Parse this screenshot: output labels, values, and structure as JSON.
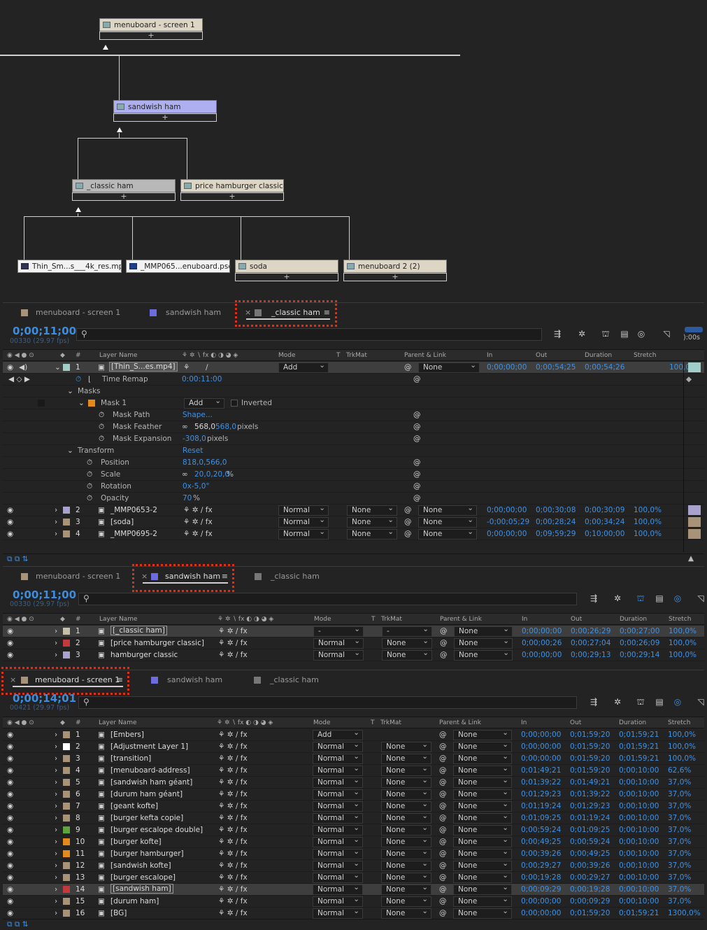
{
  "flowchart": {
    "nodes": [
      {
        "label": "menuboard - screen 1"
      },
      {
        "label": "sandwish ham"
      },
      {
        "label": "_classic ham"
      },
      {
        "label": "price hamburger classic"
      },
      {
        "label": "Thin_Sm...s___4k_res.mp4"
      },
      {
        "label": "_MMP065...enuboard.psd"
      },
      {
        "label": "soda"
      },
      {
        "label": "menuboard 2 (2)"
      }
    ],
    "plus": "+"
  },
  "panel1": {
    "tabs": [
      {
        "label": "menuboard - screen 1"
      },
      {
        "label": "sandwish ham"
      },
      {
        "label": "_classic ham"
      }
    ],
    "timecode": "0;00;11;00",
    "fps": "00330 (29.97 fps)",
    "headers": {
      "layer_name": "Layer Name",
      "mode": "Mode",
      "t": "T",
      "trkmat": "TrkMat",
      "parent": "Parent & Link",
      "in": "In",
      "out": "Out",
      "duration": "Duration",
      "stretch": "Stretch"
    },
    "timeline_label": "):00s",
    "layer1": {
      "num": "1",
      "name": "[Thin_S...es.mp4]",
      "mode": "Add",
      "parent": "None",
      "in": "0;00;00;00",
      "out": "0;00;54;25",
      "dur": "0;00;54;26",
      "stretch": "100,0%"
    },
    "props": [
      {
        "label": "Time Remap",
        "value": "0:00:11:00"
      },
      {
        "label": "Masks",
        "value": ""
      },
      {
        "label": "Mask 1",
        "value": "Add",
        "extra": "Inverted"
      },
      {
        "label": "Mask Path",
        "value": "Shape..."
      },
      {
        "label": "Mask Feather",
        "value": "568,0",
        "value2": "568,0",
        "unit": "pixels"
      },
      {
        "label": "Mask Expansion",
        "value": "-308,0",
        "unit": "pixels"
      },
      {
        "label": "Transform",
        "value": "Reset"
      },
      {
        "label": "Position",
        "value": "818,0,566,0"
      },
      {
        "label": "Scale",
        "value": "20,0,20,0",
        "unit": "%"
      },
      {
        "label": "Rotation",
        "value": "0x-5,0°"
      },
      {
        "label": "Opacity",
        "value": "70",
        "unit": "%"
      }
    ],
    "layers": [
      {
        "num": "2",
        "name": "_MMP0653-2",
        "mode": "Normal",
        "trk": "None",
        "parent": "None",
        "in": "0;00;00;00",
        "out": "0;00;30;08",
        "dur": "0;00;30;09",
        "stretch": "100,0%",
        "color": "#a9a2cc"
      },
      {
        "num": "3",
        "name": "[soda]",
        "mode": "Normal",
        "trk": "None",
        "parent": "None",
        "in": "-0;00;05;29",
        "out": "0;00;28;24",
        "dur": "0;00;34;24",
        "stretch": "100,0%",
        "color": "#a89278"
      },
      {
        "num": "4",
        "name": "_MMP0695-2",
        "mode": "Normal",
        "trk": "None",
        "parent": "None",
        "in": "0;00;00;00",
        "out": "0;09;59;29",
        "dur": "0;10;00;00",
        "stretch": "100,0%",
        "color": "#a89278"
      }
    ]
  },
  "panel2": {
    "tabs": [
      {
        "label": "menuboard - screen 1"
      },
      {
        "label": "sandwish ham"
      },
      {
        "label": "_classic ham"
      }
    ],
    "timecode": "0;00;11;00",
    "fps": "00330 (29.97 fps)",
    "layers": [
      {
        "num": "1",
        "name": "[_classic ham]",
        "mode": "-",
        "trk": "-",
        "parent": "None",
        "in": "0;00;00;00",
        "out": "0;00;26;29",
        "dur": "0;00;27;00",
        "stretch": "100,0%",
        "color": "#c6c0a8",
        "sel": true
      },
      {
        "num": "2",
        "name": "[price hamburger classic]",
        "mode": "Normal",
        "trk": "None",
        "parent": "None",
        "in": "0;00;00;26",
        "out": "0;00;27;04",
        "dur": "0;00;26;09",
        "stretch": "100,0%",
        "color": "#c3393d"
      },
      {
        "num": "3",
        "name": "hamburger classic",
        "mode": "Normal",
        "trk": "None",
        "parent": "None",
        "in": "0;00;00;00",
        "out": "0;00;29;13",
        "dur": "0;00;29;14",
        "stretch": "100,0%",
        "color": "#a9a2cc"
      }
    ]
  },
  "panel3": {
    "tabs": [
      {
        "label": "menuboard - screen 1"
      },
      {
        "label": "sandwish ham"
      },
      {
        "label": "_classic ham"
      }
    ],
    "timecode": "0;00;14;01",
    "fps": "00421 (29.97 fps)",
    "layers": [
      {
        "num": "1",
        "name": "[Embers]",
        "mode": "Add",
        "trk": "",
        "parent": "None",
        "in": "0;00;00;00",
        "out": "0;01;59;20",
        "dur": "0;01;59;21",
        "stretch": "100,0%",
        "color": "#a89278"
      },
      {
        "num": "2",
        "name": "[Adjustment Layer 1]",
        "mode": "Normal",
        "trk": "None",
        "parent": "None",
        "in": "0;00;00;00",
        "out": "0;01;59;20",
        "dur": "0;01;59;21",
        "stretch": "100,0%",
        "color": "#ffffff"
      },
      {
        "num": "3",
        "name": "[transition]",
        "mode": "Normal",
        "trk": "None",
        "parent": "None",
        "in": "0;00;00;00",
        "out": "0;01;59;20",
        "dur": "0;01;59;21",
        "stretch": "100,0%",
        "color": "#a89278"
      },
      {
        "num": "4",
        "name": "[menuboard-address]",
        "mode": "Normal",
        "trk": "None",
        "parent": "None",
        "in": "0;01;49;21",
        "out": "0;01;59;20",
        "dur": "0;00;10;00",
        "stretch": "62,6%",
        "color": "#a89278"
      },
      {
        "num": "5",
        "name": "[sandwish ham géant]",
        "mode": "Normal",
        "trk": "None",
        "parent": "None",
        "in": "0;01;39;22",
        "out": "0;01;49;21",
        "dur": "0;00;10;00",
        "stretch": "37,0%",
        "color": "#a89278"
      },
      {
        "num": "6",
        "name": "[durum ham géant]",
        "mode": "Normal",
        "trk": "None",
        "parent": "None",
        "in": "0;01;29;23",
        "out": "0;01;39;22",
        "dur": "0;00;10;00",
        "stretch": "37,0%",
        "color": "#a89278"
      },
      {
        "num": "7",
        "name": "[geant kofte]",
        "mode": "Normal",
        "trk": "None",
        "parent": "None",
        "in": "0;01;19;24",
        "out": "0;01;29;23",
        "dur": "0;00;10;00",
        "stretch": "37,0%",
        "color": "#a89278"
      },
      {
        "num": "8",
        "name": "[burger kefta copie]",
        "mode": "Normal",
        "trk": "None",
        "parent": "None",
        "in": "0;01;09;25",
        "out": "0;01;19;24",
        "dur": "0;00;10;00",
        "stretch": "37,0%",
        "color": "#a89278"
      },
      {
        "num": "9",
        "name": "[burger escalope double]",
        "mode": "Normal",
        "trk": "None",
        "parent": "None",
        "in": "0;00;59;24",
        "out": "0;01;09;25",
        "dur": "0;00;10;00",
        "stretch": "37,0%",
        "color": "#5fa63a"
      },
      {
        "num": "10",
        "name": "[burger kofte]",
        "mode": "Normal",
        "trk": "None",
        "parent": "None",
        "in": "0;00;49;25",
        "out": "0;00;59;24",
        "dur": "0;00;10;00",
        "stretch": "37,0%",
        "color": "#e48a1d"
      },
      {
        "num": "11",
        "name": "[burger hamburger]",
        "mode": "Normal",
        "trk": "None",
        "parent": "None",
        "in": "0;00;39;26",
        "out": "0;00;49;25",
        "dur": "0;00;10;00",
        "stretch": "37,0%",
        "color": "#e48a1d"
      },
      {
        "num": "12",
        "name": "[sandwish kofte]",
        "mode": "Normal",
        "trk": "None",
        "parent": "None",
        "in": "0;00;29;27",
        "out": "0;00;39;26",
        "dur": "0;00;10;00",
        "stretch": "37,0%",
        "color": "#a89278"
      },
      {
        "num": "13",
        "name": "[burger escalope]",
        "mode": "Normal",
        "trk": "None",
        "parent": "None",
        "in": "0;00;19;28",
        "out": "0;00;29;27",
        "dur": "0;00;10;00",
        "stretch": "37,0%",
        "color": "#a89278"
      },
      {
        "num": "14",
        "name": "[sandwish ham]",
        "mode": "Normal",
        "trk": "None",
        "parent": "None",
        "in": "0;00;09;29",
        "out": "0;00;19;28",
        "dur": "0;00;10;00",
        "stretch": "37,0%",
        "color": "#c3393d",
        "sel": true
      },
      {
        "num": "15",
        "name": "[durum ham]",
        "mode": "Normal",
        "trk": "None",
        "parent": "None",
        "in": "0;00;00;00",
        "out": "0;00;09;29",
        "dur": "0;00;10;00",
        "stretch": "37,0%",
        "color": "#a89278"
      },
      {
        "num": "16",
        "name": "[BG]",
        "mode": "Normal",
        "trk": "None",
        "parent": "None",
        "in": "0;00;00;00",
        "out": "0;01;59;20",
        "dur": "0;01;59;21",
        "stretch": "1300,0%",
        "color": "#a89278"
      }
    ]
  },
  "colors": {
    "timecode": "#3a8de0",
    "highlight": "#d4331c",
    "panel_bg": "#232323"
  }
}
